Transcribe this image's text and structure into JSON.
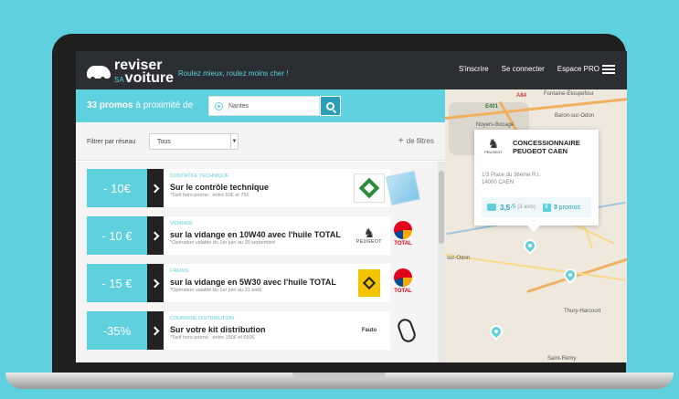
{
  "header": {
    "logo_line1": "reviser",
    "logo_sa": "SA",
    "logo_line2": "voiture",
    "tagline": "Roulez mieux, roulez moins cher !",
    "nav": [
      "S'inscrire",
      "Se connecter",
      "Espace PRO"
    ]
  },
  "search": {
    "count": "33 promos",
    "count_suffix": " à proximité de",
    "location_value": "Nantes"
  },
  "filters": {
    "label": "Filtrer par réseau",
    "select_value": "Tous",
    "more_label": "de filtres"
  },
  "promos": [
    {
      "discount": "- 10€",
      "category": "CONTRÔLE TECHNIQUE",
      "title": "Sur le contrôle technique",
      "note": "*Tarif hors promo : entre 50€ et 75€"
    },
    {
      "discount": "- 10 €",
      "category": "VIDANGE",
      "title": "sur la vidange en 10W40 avec l'huile TOTAL",
      "note": "*Opération valable du 1er juin au 30 septembre",
      "brand1": "PEUGEOT",
      "brand2": "TOTAL"
    },
    {
      "discount": "- 15 €",
      "category": "FREINS",
      "title": "sur la vidange en 5W30 avec l'huile TOTAL",
      "note": "*Opération valable du 1er juin au 31 août",
      "brand1": "RENAULT",
      "brand2": "TOTAL"
    },
    {
      "discount": "-35%",
      "category": "COURROIE DISTRIBUTION",
      "title": "Sur votre kit distribution",
      "note": "*Tarif hors promo : entre 150€ et 650€",
      "brand1": "Fauto"
    }
  ],
  "map": {
    "labels": [
      "Fontaine-Étoupefour",
      "Noyers-Bocage",
      "Baron-sur-Odon",
      "sur-Odon",
      "Thury-Harcourt",
      "Saint-Rémy",
      "A84",
      "E401"
    ],
    "popup": {
      "logo_word": "PEUGEOT",
      "title": "CONCESSIONNAIRE PEUGEOT CAEN",
      "address_line1": "1/3 Place du 36ème R.I.",
      "address_line2": "14000 CAEN",
      "rating": "3,5",
      "rating_max": "/5",
      "reviews": "(3 avis)",
      "promo_count": "3",
      "promo_label": " promos"
    }
  },
  "colors": {
    "accent": "#5fd0de",
    "header": "#2b2e33"
  }
}
